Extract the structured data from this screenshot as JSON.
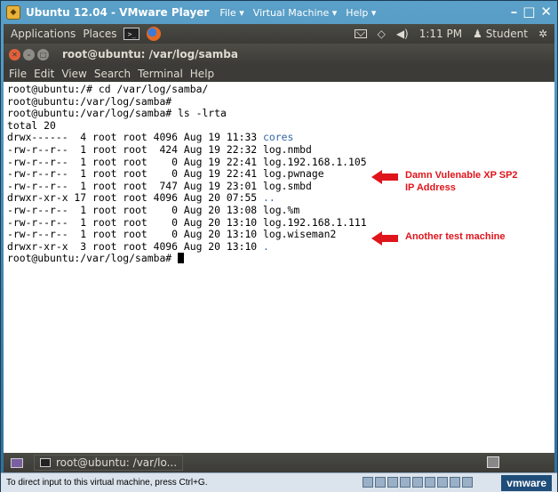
{
  "vmware": {
    "title": "Ubuntu 12.04 - VMware Player",
    "menu": [
      "File ▾",
      "Virtual Machine ▾",
      "Help ▾"
    ],
    "window_buttons": [
      "–",
      "□",
      "✕"
    ],
    "status_text": "To direct input to this virtual machine, press Ctrl+G.",
    "brand": "vmware"
  },
  "top_panel": {
    "applications": "Applications",
    "places": "Places",
    "clock": "1:11 PM",
    "user": "Student"
  },
  "terminal": {
    "window_title": "root@ubuntu: /var/log/samba",
    "menu": [
      "File",
      "Edit",
      "View",
      "Search",
      "Terminal",
      "Help"
    ],
    "lines": [
      {
        "pre": "root@ubuntu:/# cd /var/log/samba/",
        "name": "",
        "dir": false
      },
      {
        "pre": "root@ubuntu:/var/log/samba#",
        "name": "",
        "dir": false
      },
      {
        "pre": "root@ubuntu:/var/log/samba# ls -lrta",
        "name": "",
        "dir": false
      },
      {
        "pre": "total 20",
        "name": "",
        "dir": false
      },
      {
        "pre": "drwx------  4 root root 4096 Aug 19 11:33 ",
        "name": "cores",
        "dir": true
      },
      {
        "pre": "-rw-r--r--  1 root root  424 Aug 19 22:32 ",
        "name": "log.nmbd",
        "dir": false
      },
      {
        "pre": "-rw-r--r--  1 root root    0 Aug 19 22:41 ",
        "name": "log.192.168.1.105",
        "dir": false
      },
      {
        "pre": "-rw-r--r--  1 root root    0 Aug 19 22:41 ",
        "name": "log.pwnage",
        "dir": false
      },
      {
        "pre": "-rw-r--r--  1 root root  747 Aug 19 23:01 ",
        "name": "log.smbd",
        "dir": false
      },
      {
        "pre": "drwxr-xr-x 17 root root 4096 Aug 20 07:55 ",
        "name": "..",
        "dir": true
      },
      {
        "pre": "-rw-r--r--  1 root root    0 Aug 20 13:08 ",
        "name": "log.%m",
        "dir": false
      },
      {
        "pre": "-rw-r--r--  1 root root    0 Aug 20 13:10 ",
        "name": "log.192.168.1.111",
        "dir": false
      },
      {
        "pre": "-rw-r--r--  1 root root    0 Aug 20 13:10 ",
        "name": "log.wiseman2",
        "dir": false
      },
      {
        "pre": "drwxr-xr-x  3 root root 4096 Aug 20 13:10 ",
        "name": ".",
        "dir": true
      },
      {
        "pre": "root@ubuntu:/var/log/samba# ",
        "name": "",
        "dir": false
      }
    ]
  },
  "annotations": [
    {
      "text": "Damn Vulenable XP SP2\nIP Address"
    },
    {
      "text": "Another test machine"
    }
  ],
  "bottom_panel": {
    "task_label": "root@ubuntu: /var/lo..."
  },
  "colors": {
    "annotation": "#e0141b",
    "directory": "#3465a4"
  }
}
